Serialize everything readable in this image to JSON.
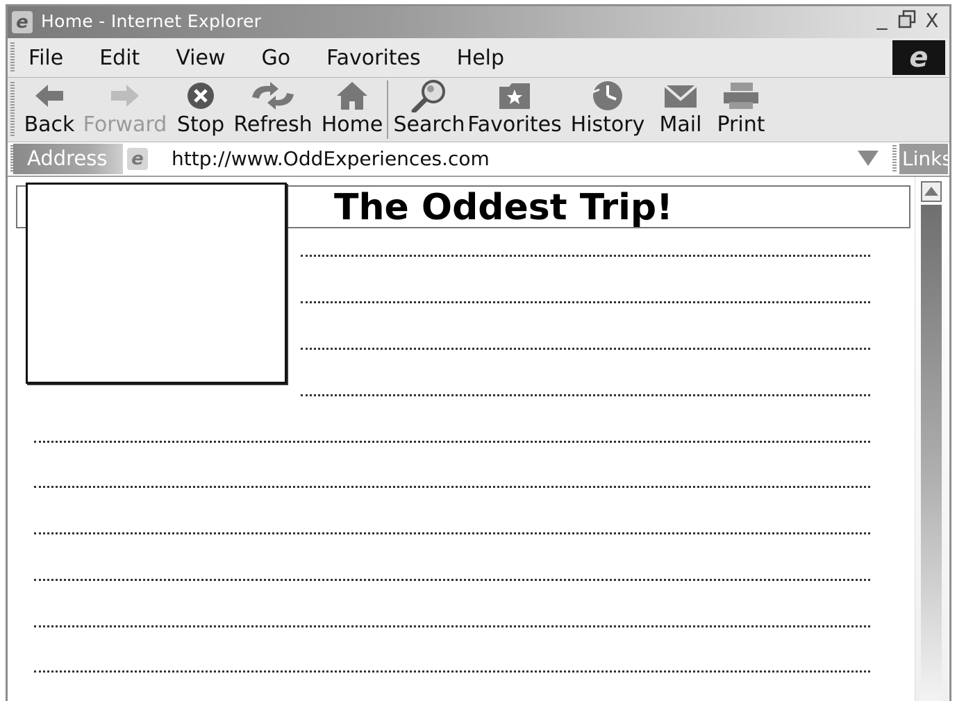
{
  "window": {
    "title": "Home -  Internet  Explorer",
    "controls": {
      "minimize": "_",
      "restore": "🗗",
      "close": "X"
    }
  },
  "menu": {
    "items": [
      "File",
      "Edit",
      "View",
      "Go",
      "Favorites",
      "Help"
    ],
    "logo_glyph": "e"
  },
  "toolbar": {
    "buttons": [
      {
        "label": "Back",
        "icon": "back-arrow-icon",
        "enabled": true
      },
      {
        "label": "Forward",
        "icon": "forward-arrow-icon",
        "enabled": false
      },
      {
        "label": "Stop",
        "icon": "stop-icon",
        "enabled": true
      },
      {
        "label": "Refresh",
        "icon": "refresh-icon",
        "enabled": true
      },
      {
        "label": "Home",
        "icon": "home-icon",
        "enabled": true
      },
      {
        "label": "Search",
        "icon": "search-icon",
        "enabled": true
      },
      {
        "label": "Favorites",
        "icon": "favorites-icon",
        "enabled": true
      },
      {
        "label": "History",
        "icon": "history-icon",
        "enabled": true
      },
      {
        "label": "Mail",
        "icon": "mail-icon",
        "enabled": true
      },
      {
        "label": "Print",
        "icon": "print-icon",
        "enabled": true
      }
    ]
  },
  "address": {
    "label": "Address",
    "url": "http://www.OddExperiences.com",
    "links_label": "Links"
  },
  "page": {
    "title": "The Oddest Trip!"
  }
}
